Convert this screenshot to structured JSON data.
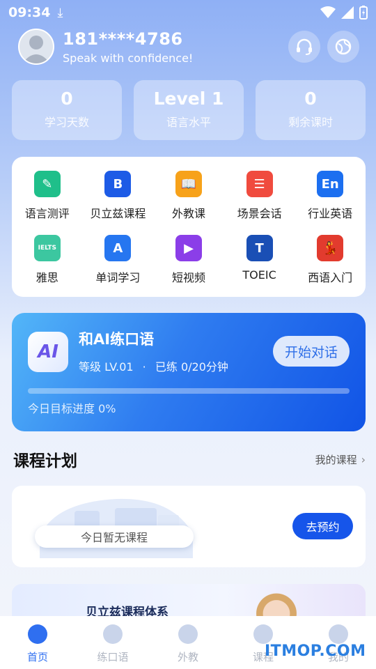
{
  "status_bar": {
    "time": "09:34"
  },
  "profile": {
    "phone": "181****4786",
    "motto": "Speak with confidence!"
  },
  "stats": [
    {
      "value": "0",
      "label": "学习天数"
    },
    {
      "value": "Level 1",
      "label": "语言水平"
    },
    {
      "value": "0",
      "label": "剩余课时"
    }
  ],
  "features": [
    {
      "label": "语言测评",
      "icon": "pen-note-icon",
      "color": "#1fbf8a",
      "glyph": "✎"
    },
    {
      "label": "贝立兹课程",
      "icon": "berlitz-b-icon",
      "color": "#1d5be6",
      "glyph": "B"
    },
    {
      "label": "外教课",
      "icon": "open-book-icon",
      "color": "#f7a21a",
      "glyph": "📖"
    },
    {
      "label": "场景会话",
      "icon": "chat-bubble-icon",
      "color": "#f04b3e",
      "glyph": "☰"
    },
    {
      "label": "行业英语",
      "icon": "en-bubble-icon",
      "color": "#1c6ff0",
      "glyph": "En"
    },
    {
      "label": "雅思",
      "icon": "ielts-icon",
      "color": "#3cc7a0",
      "glyph": "IELTS"
    },
    {
      "label": "单词学习",
      "icon": "letter-a-icon",
      "color": "#2676f0",
      "glyph": "A"
    },
    {
      "label": "短视频",
      "icon": "video-play-icon",
      "color": "#8b3ee8",
      "glyph": "▶"
    },
    {
      "label": "TOEIC",
      "icon": "toeic-globe-icon",
      "color": "#1a4fb5",
      "glyph": "T"
    },
    {
      "label": "西语入门",
      "icon": "spanish-dancer-icon",
      "color": "#e23b2e",
      "glyph": "💃"
    }
  ],
  "ai_practice": {
    "title": "和AI练口语",
    "logo_text": "AI",
    "level_text": "等级 LV.01",
    "separator": "·",
    "practiced_text": "已练 0/20分钟",
    "button_label": "开始对话",
    "progress_label": "今日目标进度 0%",
    "progress_fraction": 0
  },
  "course_plan": {
    "title": "课程计划",
    "link_label": "我的课程",
    "empty_text": "今日暂无课程",
    "book_button": "去预约"
  },
  "banner": {
    "title": "贝立兹课程体系"
  },
  "tabs": [
    {
      "label": "首页",
      "icon": "home-icon",
      "active": true
    },
    {
      "label": "练口语",
      "icon": "ai-speech-icon",
      "active": false
    },
    {
      "label": "外教",
      "icon": "teacher-icon",
      "active": false
    },
    {
      "label": "课程",
      "icon": "course-check-icon",
      "active": false
    },
    {
      "label": "我的",
      "icon": "profile-face-icon",
      "active": false
    }
  ],
  "watermark": "ITMOP.COM"
}
